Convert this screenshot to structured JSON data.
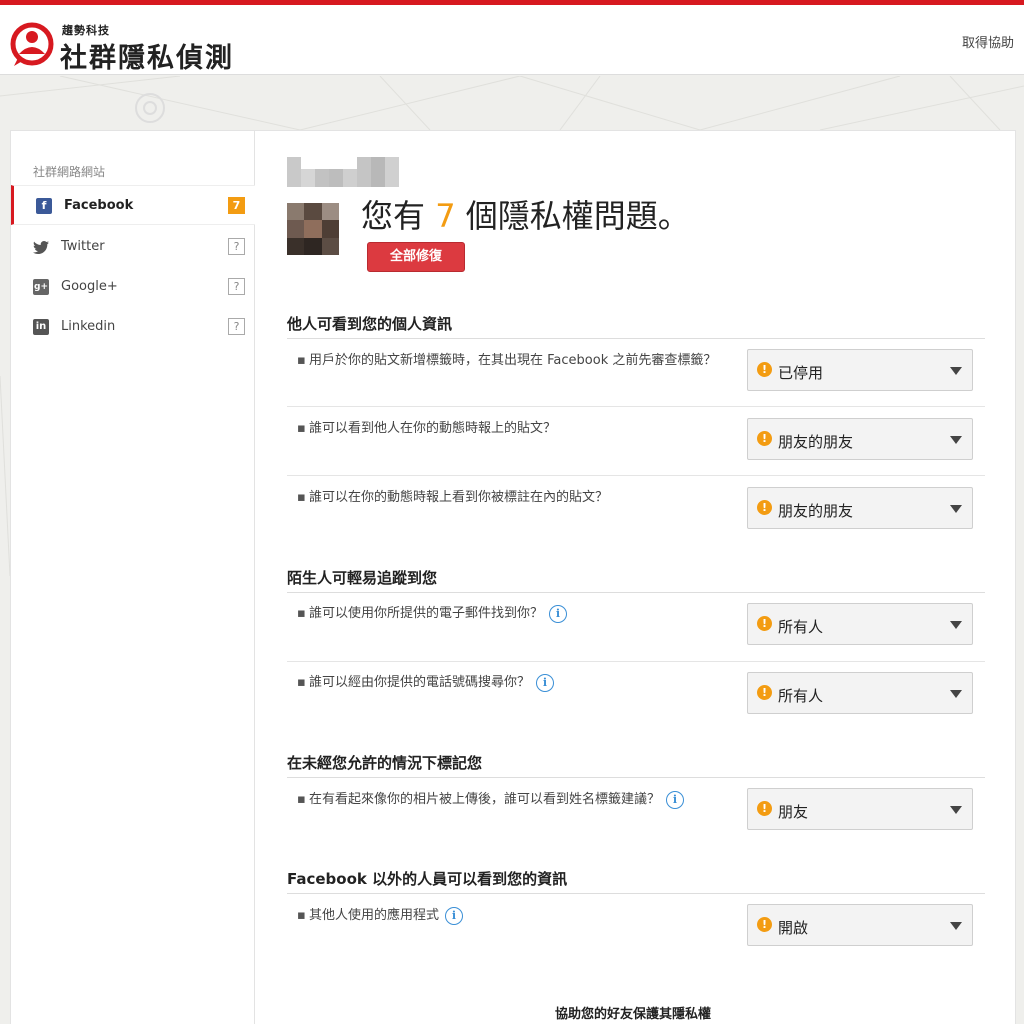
{
  "header": {
    "brand_small": "趨勢科技",
    "brand_big": "社群隱私偵測",
    "help_link": "取得協助"
  },
  "sidebar": {
    "title": "社群網路網站",
    "items": [
      {
        "label": "Facebook",
        "icon": "facebook-icon",
        "badge": "7",
        "active": true
      },
      {
        "label": "Twitter",
        "icon": "twitter-icon",
        "badge": "?",
        "active": false
      },
      {
        "label": "Google+",
        "icon": "google-plus-icon",
        "badge": "?",
        "active": false
      },
      {
        "label": "Linkedin",
        "icon": "linkedin-icon",
        "badge": "?",
        "active": false
      }
    ]
  },
  "main": {
    "headline_prefix": "您有",
    "headline_count": "7",
    "headline_suffix": "個隱私權問題。",
    "fix_all_label": "全部修復",
    "sections": [
      {
        "title": "他人可看到您的個人資訊",
        "rows": [
          {
            "question": "用戶於你的貼文新增標籤時，在其出現在 Facebook 之前先審查標籤？",
            "value": "已停用",
            "info": false
          },
          {
            "question": "誰可以看到他人在你的動態時報上的貼文？",
            "value": "朋友的朋友",
            "info": false
          },
          {
            "question": "誰可以在你的動態時報上看到你被標註在內的貼文？",
            "value": "朋友的朋友",
            "info": false
          }
        ]
      },
      {
        "title": "陌生人可輕易追蹤到您",
        "rows": [
          {
            "question": "誰可以使用你所提供的電子郵件找到你？",
            "value": "所有人",
            "info": true
          },
          {
            "question": "誰可以經由你提供的電話號碼搜尋你？",
            "value": "所有人",
            "info": true
          }
        ]
      },
      {
        "title": "在未經您允許的情況下標記您",
        "rows": [
          {
            "question": "在有看起來像你的相片被上傳後，誰可以看到姓名標籤建議？",
            "value": "朋友",
            "info": true
          }
        ]
      },
      {
        "title": "Facebook 以外的人員可以看到您的資訊",
        "rows": [
          {
            "question": "其他人使用的應用程式",
            "value": "開啟",
            "info": true
          }
        ]
      }
    ],
    "footer_text": "協助您的好友保護其隱私權"
  },
  "colors": {
    "brand_red": "#d71920",
    "warning_orange": "#f39c12",
    "fix_button": "#dc3a40",
    "info_blue": "#3a8fd6",
    "facebook_blue": "#3b5998"
  }
}
